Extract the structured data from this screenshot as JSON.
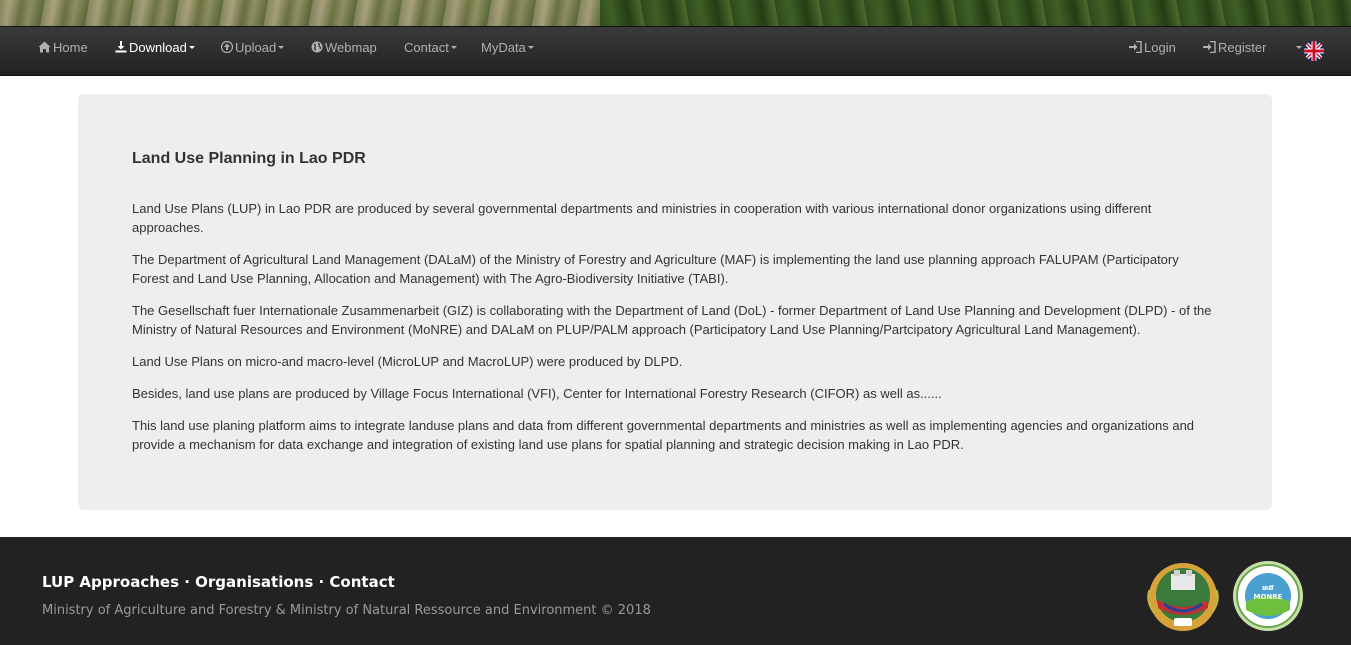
{
  "nav": {
    "home": "Home",
    "download": "Download",
    "upload": "Upload",
    "webmap": "Webmap",
    "contact": "Contact",
    "mydata": "MyData",
    "login": "Login",
    "register": "Register",
    "language_flag": "uk-flag-icon"
  },
  "main": {
    "title": "Land Use Planning in Lao PDR",
    "paragraphs": [
      "Land Use Plans (LUP) in Lao PDR are produced by several governmental departments and ministries in cooperation with various international donor organizations using different approaches.",
      "The Department of Agricultural Land Management (DALaM) of the Ministry of Forestry and Agriculture (MAF) is implementing the land use planning approach FALUPAM (Participatory Forest and Land Use Planning, Allocation and Management) with The Agro-Biodiversity Initiative (TABI).",
      "The Gesellschaft fuer Internationale Zusammenarbeit (GIZ) is collaborating with the Department of Land (DoL) - former Department of Land Use Planning and Development (DLPD) - of the Ministry of Natural Resources and Environment (MoNRE) and DALaM on PLUP/PALM approach (Participatory Land Use Planning/Partcipatory Agricultural Land Management).",
      "Land Use Plans on micro-and macro-level (MicroLUP and MacroLUP) were produced by DLPD.",
      "Besides, land use plans are produced by Village Focus International (VFI), Center for International Forestry Research (CIFOR) as well as......",
      "This land use planing platform aims to integrate landuse plans and data from different governmental departments and ministries as well as implementing agencies and organizations and provide a mechanism for data exchange and integration of existing land use plans for spatial planning and strategic decision making in Lao PDR."
    ]
  },
  "footer": {
    "link_lup": "LUP Approaches",
    "link_org": "Organisations",
    "link_contact": "Contact",
    "separator": " · ",
    "copyright": "Ministry of Agriculture and Forestry & Ministry of Natural Ressource and Environment © 2018",
    "logo_monre_text": "MONRE"
  },
  "colors": {
    "navbar": "#222222",
    "jumbotron": "#eeeeee",
    "footer": "#222222"
  }
}
